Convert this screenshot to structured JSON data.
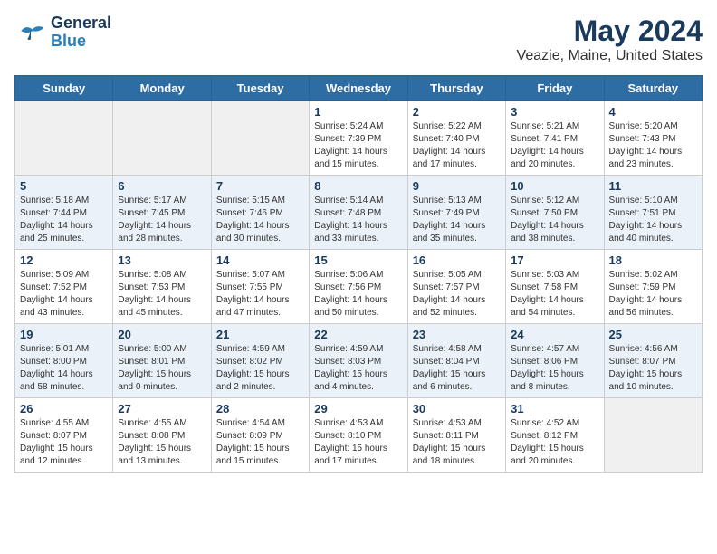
{
  "header": {
    "logo_line1": "General",
    "logo_line2": "Blue",
    "title": "May 2024",
    "subtitle": "Veazie, Maine, United States"
  },
  "calendar": {
    "weekdays": [
      "Sunday",
      "Monday",
      "Tuesday",
      "Wednesday",
      "Thursday",
      "Friday",
      "Saturday"
    ],
    "weeks": [
      [
        {
          "day": "",
          "info": ""
        },
        {
          "day": "",
          "info": ""
        },
        {
          "day": "",
          "info": ""
        },
        {
          "day": "1",
          "info": "Sunrise: 5:24 AM\nSunset: 7:39 PM\nDaylight: 14 hours\nand 15 minutes."
        },
        {
          "day": "2",
          "info": "Sunrise: 5:22 AM\nSunset: 7:40 PM\nDaylight: 14 hours\nand 17 minutes."
        },
        {
          "day": "3",
          "info": "Sunrise: 5:21 AM\nSunset: 7:41 PM\nDaylight: 14 hours\nand 20 minutes."
        },
        {
          "day": "4",
          "info": "Sunrise: 5:20 AM\nSunset: 7:43 PM\nDaylight: 14 hours\nand 23 minutes."
        }
      ],
      [
        {
          "day": "5",
          "info": "Sunrise: 5:18 AM\nSunset: 7:44 PM\nDaylight: 14 hours\nand 25 minutes."
        },
        {
          "day": "6",
          "info": "Sunrise: 5:17 AM\nSunset: 7:45 PM\nDaylight: 14 hours\nand 28 minutes."
        },
        {
          "day": "7",
          "info": "Sunrise: 5:15 AM\nSunset: 7:46 PM\nDaylight: 14 hours\nand 30 minutes."
        },
        {
          "day": "8",
          "info": "Sunrise: 5:14 AM\nSunset: 7:48 PM\nDaylight: 14 hours\nand 33 minutes."
        },
        {
          "day": "9",
          "info": "Sunrise: 5:13 AM\nSunset: 7:49 PM\nDaylight: 14 hours\nand 35 minutes."
        },
        {
          "day": "10",
          "info": "Sunrise: 5:12 AM\nSunset: 7:50 PM\nDaylight: 14 hours\nand 38 minutes."
        },
        {
          "day": "11",
          "info": "Sunrise: 5:10 AM\nSunset: 7:51 PM\nDaylight: 14 hours\nand 40 minutes."
        }
      ],
      [
        {
          "day": "12",
          "info": "Sunrise: 5:09 AM\nSunset: 7:52 PM\nDaylight: 14 hours\nand 43 minutes."
        },
        {
          "day": "13",
          "info": "Sunrise: 5:08 AM\nSunset: 7:53 PM\nDaylight: 14 hours\nand 45 minutes."
        },
        {
          "day": "14",
          "info": "Sunrise: 5:07 AM\nSunset: 7:55 PM\nDaylight: 14 hours\nand 47 minutes."
        },
        {
          "day": "15",
          "info": "Sunrise: 5:06 AM\nSunset: 7:56 PM\nDaylight: 14 hours\nand 50 minutes."
        },
        {
          "day": "16",
          "info": "Sunrise: 5:05 AM\nSunset: 7:57 PM\nDaylight: 14 hours\nand 52 minutes."
        },
        {
          "day": "17",
          "info": "Sunrise: 5:03 AM\nSunset: 7:58 PM\nDaylight: 14 hours\nand 54 minutes."
        },
        {
          "day": "18",
          "info": "Sunrise: 5:02 AM\nSunset: 7:59 PM\nDaylight: 14 hours\nand 56 minutes."
        }
      ],
      [
        {
          "day": "19",
          "info": "Sunrise: 5:01 AM\nSunset: 8:00 PM\nDaylight: 14 hours\nand 58 minutes."
        },
        {
          "day": "20",
          "info": "Sunrise: 5:00 AM\nSunset: 8:01 PM\nDaylight: 15 hours\nand 0 minutes."
        },
        {
          "day": "21",
          "info": "Sunrise: 4:59 AM\nSunset: 8:02 PM\nDaylight: 15 hours\nand 2 minutes."
        },
        {
          "day": "22",
          "info": "Sunrise: 4:59 AM\nSunset: 8:03 PM\nDaylight: 15 hours\nand 4 minutes."
        },
        {
          "day": "23",
          "info": "Sunrise: 4:58 AM\nSunset: 8:04 PM\nDaylight: 15 hours\nand 6 minutes."
        },
        {
          "day": "24",
          "info": "Sunrise: 4:57 AM\nSunset: 8:06 PM\nDaylight: 15 hours\nand 8 minutes."
        },
        {
          "day": "25",
          "info": "Sunrise: 4:56 AM\nSunset: 8:07 PM\nDaylight: 15 hours\nand 10 minutes."
        }
      ],
      [
        {
          "day": "26",
          "info": "Sunrise: 4:55 AM\nSunset: 8:07 PM\nDaylight: 15 hours\nand 12 minutes."
        },
        {
          "day": "27",
          "info": "Sunrise: 4:55 AM\nSunset: 8:08 PM\nDaylight: 15 hours\nand 13 minutes."
        },
        {
          "day": "28",
          "info": "Sunrise: 4:54 AM\nSunset: 8:09 PM\nDaylight: 15 hours\nand 15 minutes."
        },
        {
          "day": "29",
          "info": "Sunrise: 4:53 AM\nSunset: 8:10 PM\nDaylight: 15 hours\nand 17 minutes."
        },
        {
          "day": "30",
          "info": "Sunrise: 4:53 AM\nSunset: 8:11 PM\nDaylight: 15 hours\nand 18 minutes."
        },
        {
          "day": "31",
          "info": "Sunrise: 4:52 AM\nSunset: 8:12 PM\nDaylight: 15 hours\nand 20 minutes."
        },
        {
          "day": "",
          "info": ""
        }
      ]
    ]
  }
}
